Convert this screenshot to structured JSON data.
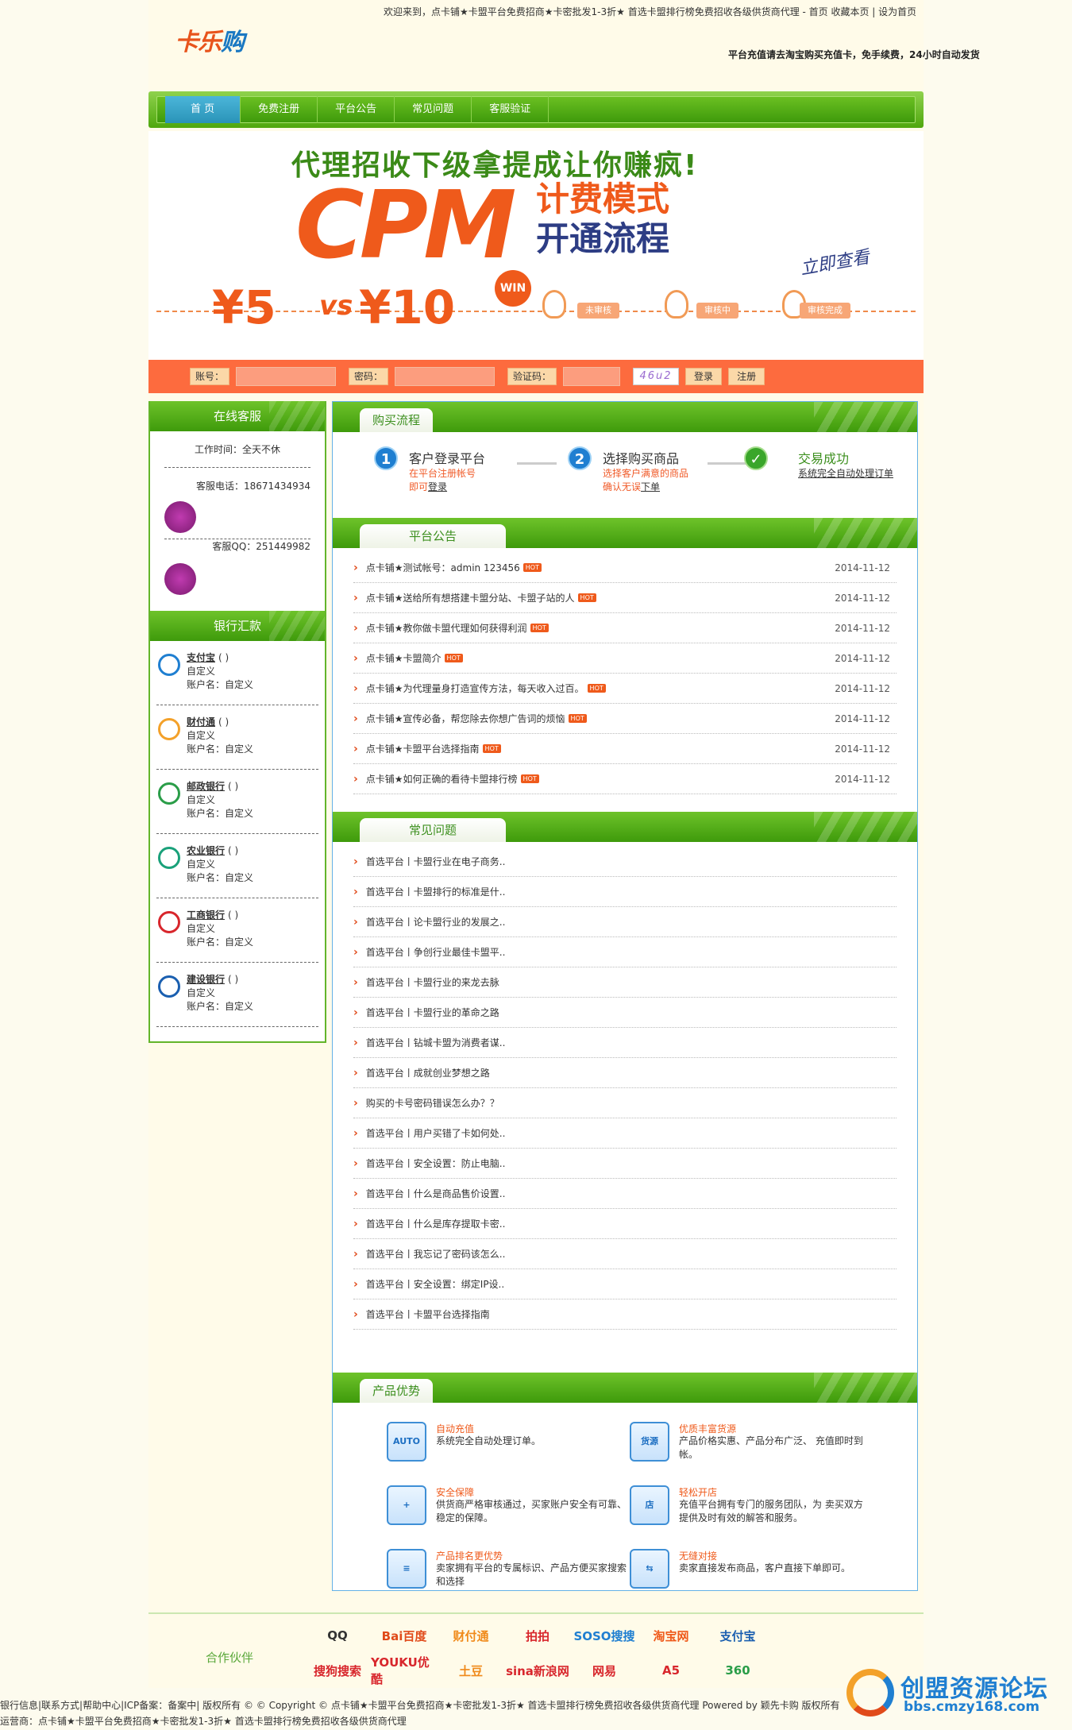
{
  "header": {
    "logo_text_a": "卡乐",
    "logo_text_b": "购",
    "top_text": "欢迎来到，点卡铺★卡盟平台免费招商★卡密批发1-3折★ 首选卡盟排行榜免费招收各级供货商代理 - 首页 收藏本页 | 设为首页",
    "slogan": "平台充值请去淘宝购买充值卡，免手续费，24小时自动发货"
  },
  "nav": [
    {
      "label": "首 页",
      "active": true
    },
    {
      "label": "免费注册"
    },
    {
      "label": "平台公告"
    },
    {
      "label": "常见问题"
    },
    {
      "label": "客服验证"
    }
  ],
  "banner": {
    "title": "代理招收下级拿提成让你赚疯!",
    "cpm": "CPM",
    "line2": "计费模式",
    "line3": "开通流程",
    "price1": "¥5",
    "vs": "vs",
    "price2": "¥10",
    "win": "WIN",
    "link": "立即查看",
    "steps": [
      "未审核",
      "审核中",
      "审核完成"
    ],
    "slide_count": 5,
    "slide_active": 3
  },
  "login": {
    "account_label": "账号：",
    "password_label": "密码：",
    "captcha_label": "验证码：",
    "captcha_code": "46u2",
    "login_btn": "登录",
    "register_btn": "注册"
  },
  "sidebar": {
    "online_title": "在线客服",
    "worktime": "工作时间：全天不休",
    "phone": "客服电话：18671434934",
    "qq": "客服QQ：251449982",
    "bank_title": "银行汇款",
    "banks": [
      {
        "name": "支付宝",
        "suffix": "( )",
        "line2": "自定义",
        "line3": "账户名：自定义",
        "color": "#1f7fd1"
      },
      {
        "name": "财付通",
        "suffix": "( )",
        "line2": "自定义",
        "line3": "账户名：自定义",
        "color": "#f3a12a"
      },
      {
        "name": "邮政银行",
        "suffix": "( )",
        "line2": "自定义",
        "line3": "账户名：自定义",
        "color": "#2a9d48"
      },
      {
        "name": "农业银行",
        "suffix": "( )",
        "line2": "自定义",
        "line3": "账户名：自定义",
        "color": "#1aa17a"
      },
      {
        "name": "工商银行",
        "suffix": "( )",
        "line2": "自定义",
        "line3": "账户名：自定义",
        "color": "#d8262c"
      },
      {
        "name": "建设银行",
        "suffix": "( )",
        "line2": "自定义",
        "line3": "账户名：自定义",
        "color": "#1a5fb0"
      }
    ]
  },
  "flow": {
    "tab": "购买流程",
    "step1_title": "客户登录平台",
    "step1_sub1": "在平台注册帐号",
    "step1_sub2a": "即可",
    "step1_sub2b": "登录",
    "step2_title": "选择购买商品",
    "step2_sub1": "选择客户满意的商品",
    "step2_sub2a": "确认无误",
    "step2_sub2b": "下单",
    "step3_title": "交易成功",
    "step3_sub": "系统完全自动处理订单"
  },
  "notice": {
    "tab": "平台公告",
    "hot": "HOT",
    "items": [
      {
        "text": "点卡铺★测试帐号：admin 123456",
        "date": "2014-11-12"
      },
      {
        "text": "点卡铺★送给所有想搭建卡盟分站、卡盟子站的人",
        "date": "2014-11-12"
      },
      {
        "text": "点卡铺★教你做卡盟代理如何获得利润",
        "date": "2014-11-12"
      },
      {
        "text": "点卡铺★卡盟简介",
        "date": "2014-11-12"
      },
      {
        "text": "点卡铺★为代理量身打造宣传方法，每天收入过百。",
        "date": "2014-11-12"
      },
      {
        "text": "点卡铺★宣传必备，帮您除去你想广告词的烦恼",
        "date": "2014-11-12"
      },
      {
        "text": "点卡铺★卡盟平台选择指南",
        "date": "2014-11-12"
      },
      {
        "text": "点卡铺★如何正确的看待卡盟排行榜",
        "date": "2014-11-12"
      }
    ]
  },
  "faq": {
    "tab": "常见问题",
    "items": [
      "首选平台丨卡盟行业在电子商务..",
      "首选平台丨卡盟排行的标准是什..",
      "首选平台丨论卡盟行业的发展之..",
      "首选平台丨争创行业最佳卡盟平..",
      "首选平台丨卡盟行业的来龙去脉",
      "首选平台丨卡盟行业的革命之路",
      "首选平台丨钻城卡盟为消费者谋..",
      "首选平台丨成就创业梦想之路",
      "购买的卡号密码错误怎么办？？",
      "首选平台丨用户买错了卡如何处..",
      "首选平台丨安全设置：防止电脑..",
      "首选平台丨什么是商品售价设置..",
      "首选平台丨什么是库存提取卡密..",
      "首选平台丨我忘记了密码该怎么..",
      "首选平台丨安全设置：绑定IP设..",
      "首选平台丨卡盟平台选择指南"
    ]
  },
  "advantages": {
    "tab": "产品优势",
    "items": [
      {
        "icon": "AUTO",
        "title": "自动充值",
        "desc": "系统完全自动处理订单。"
      },
      {
        "icon": "货源",
        "title": "优质丰富货源",
        "desc": "产品价格实惠、产品分布广泛、 充值即时到帐。"
      },
      {
        "icon": "+",
        "title": "安全保障",
        "desc": "供货商严格审核通过，买家账户安全有可靠、稳定的保障。"
      },
      {
        "icon": "店",
        "title": "轻松开店",
        "desc": "充值平台拥有专门的服务团队，为 卖买双方提供及时有效的解答和服务。"
      },
      {
        "icon": "≡",
        "title": "产品排名更优势",
        "desc": "卖家拥有平台的专属标识、产品方便买家搜索和选择"
      },
      {
        "icon": "⇆",
        "title": "无缝对接",
        "desc": "卖家直接发布商品，客户直接下单即可。"
      }
    ]
  },
  "partners": {
    "label": "合作伙伴",
    "logos": [
      {
        "t": "QQ",
        "c": "#333"
      },
      {
        "t": "Bai百度",
        "c": "#e04a1a"
      },
      {
        "t": "财付通",
        "c": "#f08a1a"
      },
      {
        "t": "拍拍",
        "c": "#d8262c"
      },
      {
        "t": "SOSO搜搜",
        "c": "#1f7fd1"
      },
      {
        "t": "淘宝网",
        "c": "#ef5a1b"
      },
      {
        "t": "支付宝",
        "c": "#1a5fb0"
      },
      {
        "t": "搜狗搜索",
        "c": "#d8262c"
      },
      {
        "t": "YOUKU优酷",
        "c": "#d8262c"
      },
      {
        "t": "土豆",
        "c": "#f08a1a"
      },
      {
        "t": "sina新浪网",
        "c": "#d8262c"
      },
      {
        "t": "网易",
        "c": "#d8262c"
      },
      {
        "t": "A5",
        "c": "#d8262c"
      },
      {
        "t": "360",
        "c": "#2a9d48"
      }
    ]
  },
  "footer": {
    "line1": "银行信息|联系方式|帮助中心|ICP备案：备案中|   版权所有 © © Copyright © 点卡铺★卡盟平台免费招商★卡密批发1-3折★ 首选卡盟排行榜免费招收各级供货商代理 Powered by 颖先卡购 版权所有",
    "line2": "运营商：点卡铺★卡盟平台免费招商★卡密批发1-3折★ 首选卡盟排行榜免费招收各级供货商代理"
  },
  "watermark": {
    "title": "创盟资源论坛",
    "url": "bbs.cmzy168.com"
  }
}
